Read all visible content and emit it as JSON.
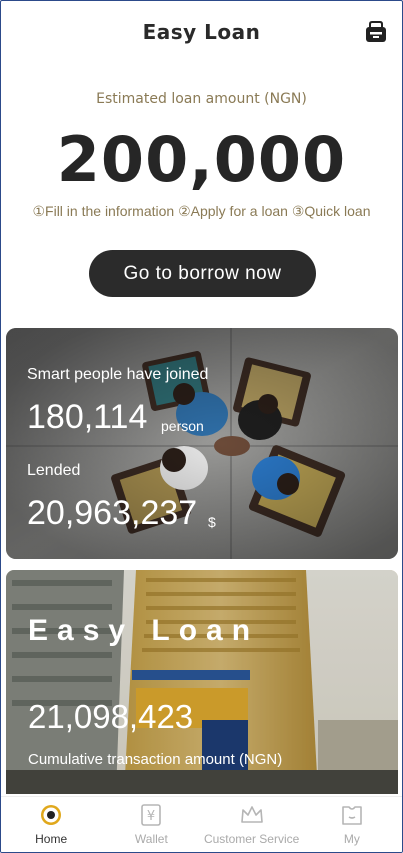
{
  "header": {
    "title": "Easy Loan",
    "message_icon": "mailbox-icon"
  },
  "estimate": {
    "label": "Estimated loan amount (NGN)",
    "amount": "200,000",
    "steps": "①Fill in the information ②Apply for a loan ③Quick loan"
  },
  "cta": {
    "label": "Go to borrow now"
  },
  "stats_card": {
    "joined_label": "Smart people have joined",
    "joined_value": "180,114",
    "joined_unit": "person",
    "lended_label": "Lended",
    "lended_value": "20,963,237",
    "lended_unit": "$"
  },
  "brand_card": {
    "brand": "Easy Loan",
    "transaction_value": "21,098,423",
    "transaction_label": "Cumulative transaction amount (NGN)"
  },
  "tabbar": {
    "items": [
      {
        "label": "Home",
        "icon": "home-icon",
        "active": true
      },
      {
        "label": "Wallet",
        "icon": "wallet-icon",
        "active": false
      },
      {
        "label": "Customer Service",
        "icon": "crown-icon",
        "active": false
      },
      {
        "label": "My",
        "icon": "user-icon",
        "active": false
      }
    ]
  },
  "colors": {
    "accent": "#e0a81c",
    "button": "#2b2b2b",
    "muted": "#8a7a55"
  }
}
